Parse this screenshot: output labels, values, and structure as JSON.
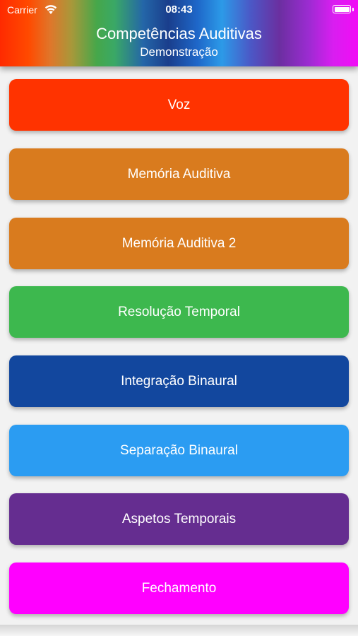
{
  "status_bar": {
    "carrier": "Carrier",
    "time": "08:43",
    "wifi_icon": "wifi-icon",
    "battery_icon": "battery-icon"
  },
  "header": {
    "title": "Competências Auditivas",
    "subtitle": "Demonstração"
  },
  "buttons": [
    {
      "label": "Voz",
      "color": "#ff3300"
    },
    {
      "label": "Memória Auditiva",
      "color": "#d97b1e"
    },
    {
      "label": "Memória Auditiva 2",
      "color": "#d97b1e"
    },
    {
      "label": "Resolução Temporal",
      "color": "#3db84e"
    },
    {
      "label": "Integração Binaural",
      "color": "#12479e"
    },
    {
      "label": "Separação Binaural",
      "color": "#2b9cf2"
    },
    {
      "label": "Aspetos Temporais",
      "color": "#652d90"
    },
    {
      "label": "Fechamento",
      "color": "#ff00ff"
    }
  ]
}
